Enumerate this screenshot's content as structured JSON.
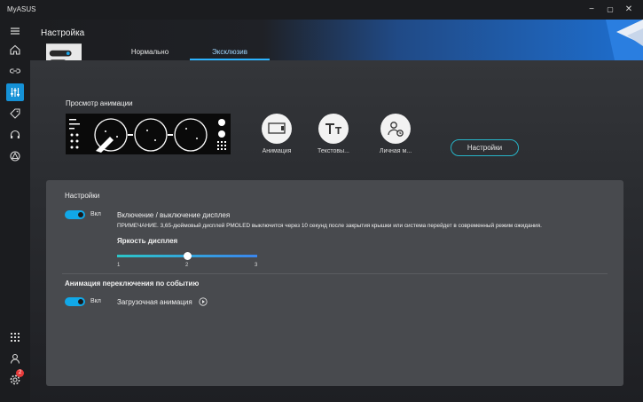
{
  "app": {
    "title": "MyASUS"
  },
  "window": {
    "minimize": "−",
    "maximize": "▢",
    "close": "✕"
  },
  "header": {
    "title": "Настройка",
    "tabs": [
      {
        "label": "Нормально",
        "active": false
      },
      {
        "label": "Эксклюзив",
        "active": true
      }
    ]
  },
  "sidebar": {
    "items": [
      {
        "icon": "hamburger-menu-icon"
      },
      {
        "icon": "home-icon"
      },
      {
        "icon": "link-icon"
      },
      {
        "icon": "sliders-icon",
        "active": true
      },
      {
        "icon": "tag-icon"
      },
      {
        "icon": "headset-icon"
      },
      {
        "icon": "triangle-circle-icon"
      }
    ],
    "bottom": [
      {
        "icon": "apps-grid-icon"
      },
      {
        "icon": "user-icon"
      },
      {
        "icon": "gear-icon",
        "badge": "2"
      }
    ]
  },
  "preview": {
    "title": "Просмотр анимации",
    "modes": [
      {
        "label": "Анимация",
        "icon": "monitor-icon"
      },
      {
        "label": "Текстовы...",
        "icon": "text-icon"
      },
      {
        "label": "Личная м...",
        "icon": "person-clock-icon"
      }
    ],
    "settings_button": "Настройки"
  },
  "settings_panel": {
    "title": "Настройки",
    "display_toggle": {
      "state_label": "Вкл",
      "on": true
    },
    "display_title": "Включение / выключение дисплея",
    "display_note": "ПРИМЕЧАНИЕ. 3,65-дюймовый дисплей PMOLED выключится через 10 секунд после закрытия крышки или система перейдет в современный режим ожидания.",
    "brightness": {
      "label": "Яркость дисплея",
      "min": 1,
      "max": 3,
      "value": 2,
      "ticks": [
        "1",
        "2",
        "3"
      ]
    },
    "event_section_title": "Анимация переключения по событию",
    "boot_toggle": {
      "state_label": "Вкл",
      "on": true
    },
    "boot_animation_label": "Загрузочная анимация"
  },
  "colors": {
    "accent": "#11a8e8",
    "active_tab": "#2cb3ff",
    "badge": "#e53a3a",
    "panel": "#484a4e"
  }
}
